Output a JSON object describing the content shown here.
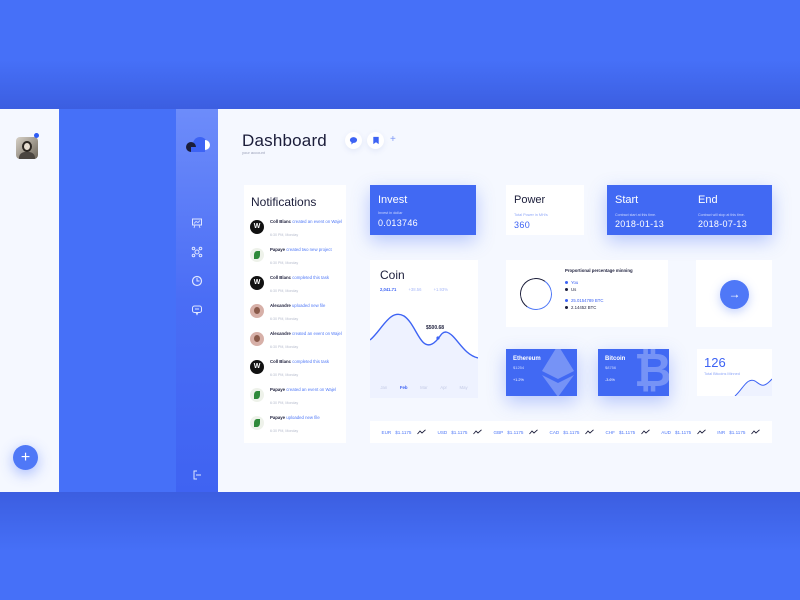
{
  "colors": {
    "accent": "#4169f3",
    "background": "#4670f8",
    "panel": "#f5f8ff",
    "text_dark": "#1b1d3a"
  },
  "left_panel": {
    "avatar_icon": "user-avatar",
    "notification_dot": true,
    "fab_label": "+"
  },
  "sidebar": {
    "logo": "cloud-logo",
    "items": [
      {
        "icon": "presentation-chart-icon"
      },
      {
        "icon": "network-icon"
      },
      {
        "icon": "clock-pie-icon"
      },
      {
        "icon": "chat-monitor-icon"
      }
    ],
    "logout_icon": "logout-icon"
  },
  "header": {
    "title": "Dashboard",
    "subtitle": "your account",
    "buttons": [
      {
        "icon": "chat-bubble-icon",
        "glyph": "💬"
      },
      {
        "icon": "bookmark-icon",
        "glyph": "🔖"
      }
    ],
    "add_label": "+"
  },
  "notifications": {
    "title": "Notifications",
    "items": [
      {
        "user": "Coll Blanc",
        "action": "created an event on Wajel",
        "time": "6:30 PM, Monday",
        "avatar": "w"
      },
      {
        "user": "Papaye",
        "action": "created two new project",
        "time": "6:30 PM, Monday",
        "avatar": "p"
      },
      {
        "user": "Coll Blanc",
        "action": "completed this task",
        "time": "6:30 PM, Monday",
        "avatar": "w"
      },
      {
        "user": "Alexandre",
        "action": "uploaded new file",
        "time": "6:30 PM, Monday",
        "avatar": "a"
      },
      {
        "user": "Alexandre",
        "action": "created an event on Wajel",
        "time": "6:30 PM, Monday",
        "avatar": "a"
      },
      {
        "user": "Coll Blanc",
        "action": "completed this task",
        "time": "6:30 PM, Monday",
        "avatar": "w"
      },
      {
        "user": "Papaye",
        "action": "created an event on Wajel",
        "time": "6:30 PM, Monday",
        "avatar": "p"
      },
      {
        "user": "Papaye",
        "action": "uploaded new file",
        "time": "6:30 PM, Monday",
        "avatar": "p"
      }
    ]
  },
  "invest": {
    "title": "Invest",
    "label": "Invest in dollar",
    "value": "0.013746"
  },
  "power": {
    "title": "Power",
    "label": "Total Power in MH/s",
    "value": "360"
  },
  "contract": {
    "start": {
      "title": "Start",
      "label": "Contract start at this time.",
      "value": "2018-01-13"
    },
    "end": {
      "title": "End",
      "label": "Contract will stop at this time.",
      "value": "2018-07-13"
    }
  },
  "coin": {
    "title": "Coin",
    "value": "2,041.71",
    "change": "+38.56",
    "change_pct": "+1.93%",
    "tooltip": "$500.68",
    "months": [
      "Jan",
      "Feb",
      "Mar",
      "Apr",
      "May"
    ],
    "active_month": "Feb"
  },
  "mining": {
    "title": "Proportional percentage minning",
    "legend": [
      {
        "label": "You",
        "color": "#3d63f4"
      },
      {
        "label": "Us",
        "color": "#1b1d3a"
      }
    ],
    "values": [
      {
        "label": "25.0154789 BTC",
        "color": "#3d63f4"
      },
      {
        "label": "2.14452 BTC",
        "color": "#1b1d3a"
      }
    ]
  },
  "next_button": {
    "icon": "arrow-right-icon",
    "glyph": "→"
  },
  "ethereum": {
    "title": "Ethereum",
    "price": "$1254",
    "change": "+1.2%"
  },
  "bitcoin": {
    "title": "Bitcoin",
    "price": "$8756",
    "change": "-3.6%"
  },
  "mined": {
    "value": "126",
    "label": "Total Bitcoins Minned"
  },
  "currencies": [
    {
      "code": "EUR",
      "value": "$1.1175"
    },
    {
      "code": "USD",
      "value": "$1.1175"
    },
    {
      "code": "GBP",
      "value": "$1.1175"
    },
    {
      "code": "CAD",
      "value": "$1.1175"
    },
    {
      "code": "CHF",
      "value": "$1.1175"
    },
    {
      "code": "AUD",
      "value": "$1.1175"
    },
    {
      "code": "INR",
      "value": "$1.1175"
    }
  ]
}
